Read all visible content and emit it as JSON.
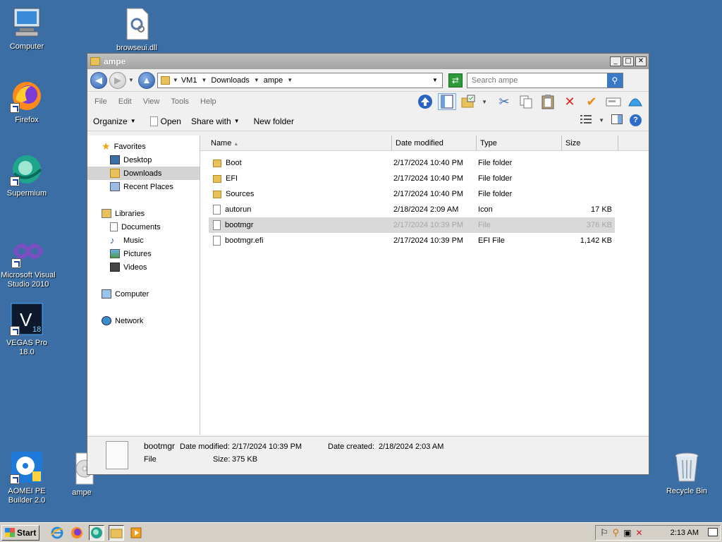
{
  "desktop": {
    "icons": [
      {
        "label": "Computer"
      },
      {
        "label": "browseui.dll"
      },
      {
        "label": "Firefox"
      },
      {
        "label": "Supermium"
      },
      {
        "label": "Microsoft Visual Studio 2010"
      },
      {
        "label": "VEGAS Pro 18.0"
      },
      {
        "label": "AOMEI PE Builder 2.0"
      },
      {
        "label": "ampe"
      },
      {
        "label": "Recycle Bin"
      }
    ]
  },
  "window": {
    "title": "ampe",
    "controls": {
      "minimize": "_",
      "maximize": "□",
      "close": "✕"
    },
    "breadcrumb": [
      "VM1",
      "Downloads",
      "ampe"
    ],
    "search_placeholder": "Search ampe",
    "menu": [
      "File",
      "Edit",
      "View",
      "Tools",
      "Help"
    ],
    "commands": {
      "organize": "Organize",
      "open": "Open",
      "share_with": "Share with",
      "new_folder": "New folder"
    },
    "nav": {
      "favorites": "Favorites",
      "desktop": "Desktop",
      "downloads": "Downloads",
      "recent_places": "Recent Places",
      "libraries": "Libraries",
      "documents": "Documents",
      "music": "Music",
      "pictures": "Pictures",
      "videos": "Videos",
      "computer": "Computer",
      "network": "Network"
    },
    "columns": {
      "name": "Name",
      "date": "Date modified",
      "type": "Type",
      "size": "Size"
    },
    "files": [
      {
        "name": "Boot",
        "date": "2/17/2024 10:40 PM",
        "type": "File folder",
        "size": ""
      },
      {
        "name": "EFI",
        "date": "2/17/2024 10:40 PM",
        "type": "File folder",
        "size": ""
      },
      {
        "name": "Sources",
        "date": "2/17/2024 10:40 PM",
        "type": "File folder",
        "size": ""
      },
      {
        "name": "autorun",
        "date": "2/18/2024 2:09 AM",
        "type": "Icon",
        "size": "17 KB"
      },
      {
        "name": "bootmgr",
        "date": "2/17/2024 10:39 PM",
        "type": "File",
        "size": "376 KB"
      },
      {
        "name": "bootmgr.efi",
        "date": "2/17/2024 10:39 PM",
        "type": "EFI File",
        "size": "1,142 KB"
      }
    ],
    "details": {
      "name": "bootmgr",
      "kind": "File",
      "date_modified_label": "Date modified:",
      "date_modified": "2/17/2024 10:39 PM",
      "date_created_label": "Date created:",
      "date_created": "2/18/2024 2:03 AM",
      "size_label": "Size:",
      "size": "375 KB"
    }
  },
  "taskbar": {
    "start_label": "Start",
    "clock": "2:13 AM"
  }
}
